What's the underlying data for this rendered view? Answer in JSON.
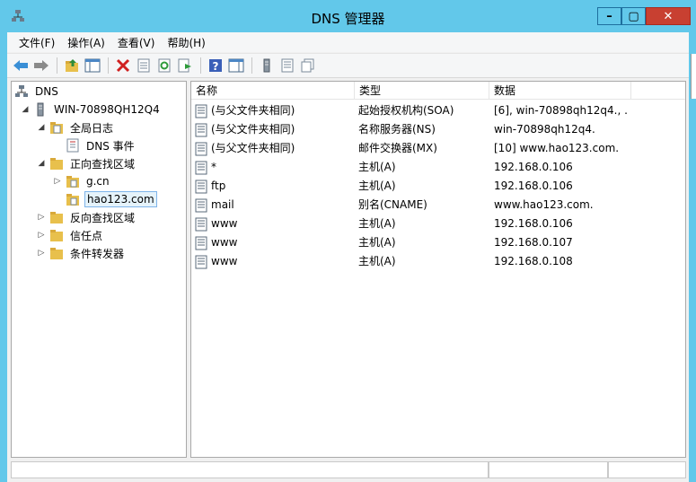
{
  "window": {
    "title": "DNS 管理器",
    "controls": {
      "minimize": "–",
      "maximize": "▢",
      "close": "✕"
    }
  },
  "menubar": {
    "items": [
      {
        "label": "文件(F)"
      },
      {
        "label": "操作(A)"
      },
      {
        "label": "查看(V)"
      },
      {
        "label": "帮助(H)"
      }
    ]
  },
  "toolbar": {
    "buttons": [
      "back-arrow-icon",
      "forward-arrow-icon",
      "up-folder-icon",
      "show-hide-tree-icon",
      "delete-icon",
      "properties-icon",
      "refresh-icon",
      "export-list-icon",
      "help-icon",
      "action-pane-icon",
      "server-icon",
      "zone-list-icon",
      "copy-icon"
    ]
  },
  "tree": {
    "nodes": [
      {
        "label": "DNS",
        "icon": "dns-root-icon",
        "expander": ""
      },
      {
        "label": "WIN-70898QH12Q4",
        "icon": "server-icon",
        "expander": "◢"
      },
      {
        "label": "全局日志",
        "icon": "log-folder-icon",
        "expander": "◢"
      },
      {
        "label": "DNS 事件",
        "icon": "event-log-icon",
        "expander": ""
      },
      {
        "label": "正向查找区域",
        "icon": "folder-icon",
        "expander": "◢"
      },
      {
        "label": "g.cn",
        "icon": "zone-icon",
        "expander": "▷"
      },
      {
        "label": "hao123.com",
        "icon": "zone-icon",
        "expander": ""
      },
      {
        "label": "反向查找区域",
        "icon": "folder-icon",
        "expander": "▷"
      },
      {
        "label": "信任点",
        "icon": "folder-icon",
        "expander": "▷"
      },
      {
        "label": "条件转发器",
        "icon": "folder-icon",
        "expander": "▷"
      }
    ],
    "selected": "hao123.com"
  },
  "list": {
    "columns": [
      "名称",
      "类型",
      "数据"
    ],
    "rows": [
      {
        "name": "(与父文件夹相同)",
        "type": "起始授权机构(SOA)",
        "data": "[6], win-70898qh12q4., ..."
      },
      {
        "name": "(与父文件夹相同)",
        "type": "名称服务器(NS)",
        "data": "win-70898qh12q4."
      },
      {
        "name": "(与父文件夹相同)",
        "type": "邮件交换器(MX)",
        "data": "[10]  www.hao123.com."
      },
      {
        "name": "*",
        "type": "主机(A)",
        "data": "192.168.0.106"
      },
      {
        "name": "ftp",
        "type": "主机(A)",
        "data": "192.168.0.106"
      },
      {
        "name": "mail",
        "type": "别名(CNAME)",
        "data": "www.hao123.com."
      },
      {
        "name": "www",
        "type": "主机(A)",
        "data": "192.168.0.106"
      },
      {
        "name": "www",
        "type": "主机(A)",
        "data": "192.168.0.107"
      },
      {
        "name": "www",
        "type": "主机(A)",
        "data": "192.168.0.108"
      }
    ]
  },
  "colors": {
    "titlebar": "#62c8ea",
    "close": "#c84031",
    "selection": "#e5f3fb"
  }
}
